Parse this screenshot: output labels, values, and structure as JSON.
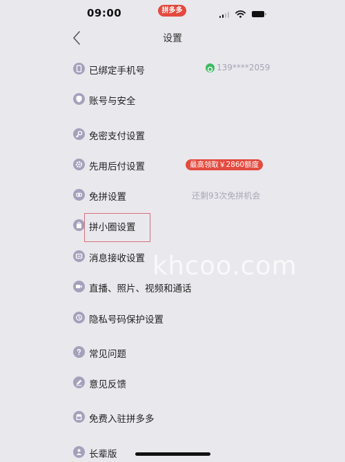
{
  "status_bar": {
    "time": "09:00",
    "app_badge": "拼多多",
    "signal_icon": "signal-bars-icon",
    "wifi_icon": "wifi-icon",
    "battery_icon": "battery-icon"
  },
  "nav": {
    "back_icon": "chevron-left-icon",
    "title": "设置"
  },
  "settings": {
    "bound_phone": {
      "label": "已绑定手机号",
      "value": "139****2059",
      "icon": "phone-icon",
      "status_icon": "verified-shield-icon"
    },
    "account_security": {
      "label": "账号与安全",
      "icon": "shield-icon"
    },
    "password_free_pay": {
      "label": "免密支付设置",
      "icon": "key-icon"
    },
    "pay_later": {
      "label": "先用后付设置",
      "icon": "gear-icon",
      "badge": "最高领取￥2860额度"
    },
    "free_group": {
      "label": "免拼设置",
      "icon": "link-icon",
      "hint": "还剩93次免拼机会"
    },
    "pin_circle": {
      "label": "拼小圈设置",
      "icon": "bag-icon"
    },
    "notifications": {
      "label": "消息接收设置",
      "icon": "message-icon"
    },
    "media_permissions": {
      "label": "直播、照片、视频和通话",
      "icon": "video-icon"
    },
    "privacy_number": {
      "label": "隐私号码保护设置",
      "icon": "privacy-icon"
    },
    "faq": {
      "label": "常见问题",
      "icon": "question-icon"
    },
    "feedback": {
      "label": "意见反馈",
      "icon": "pencil-icon"
    },
    "merchant": {
      "label": "免费入驻拼多多",
      "icon": "store-icon"
    },
    "elder_mode": {
      "label": "长辈版",
      "icon": "person-icon"
    }
  },
  "watermark": "khcoo.com",
  "colors": {
    "background": "#e9e8ed",
    "accent_red": "#e44a3f",
    "icon_purple": "#a4a1bb",
    "verified_green": "#3dbb63",
    "muted_text": "#a8a6b6"
  }
}
